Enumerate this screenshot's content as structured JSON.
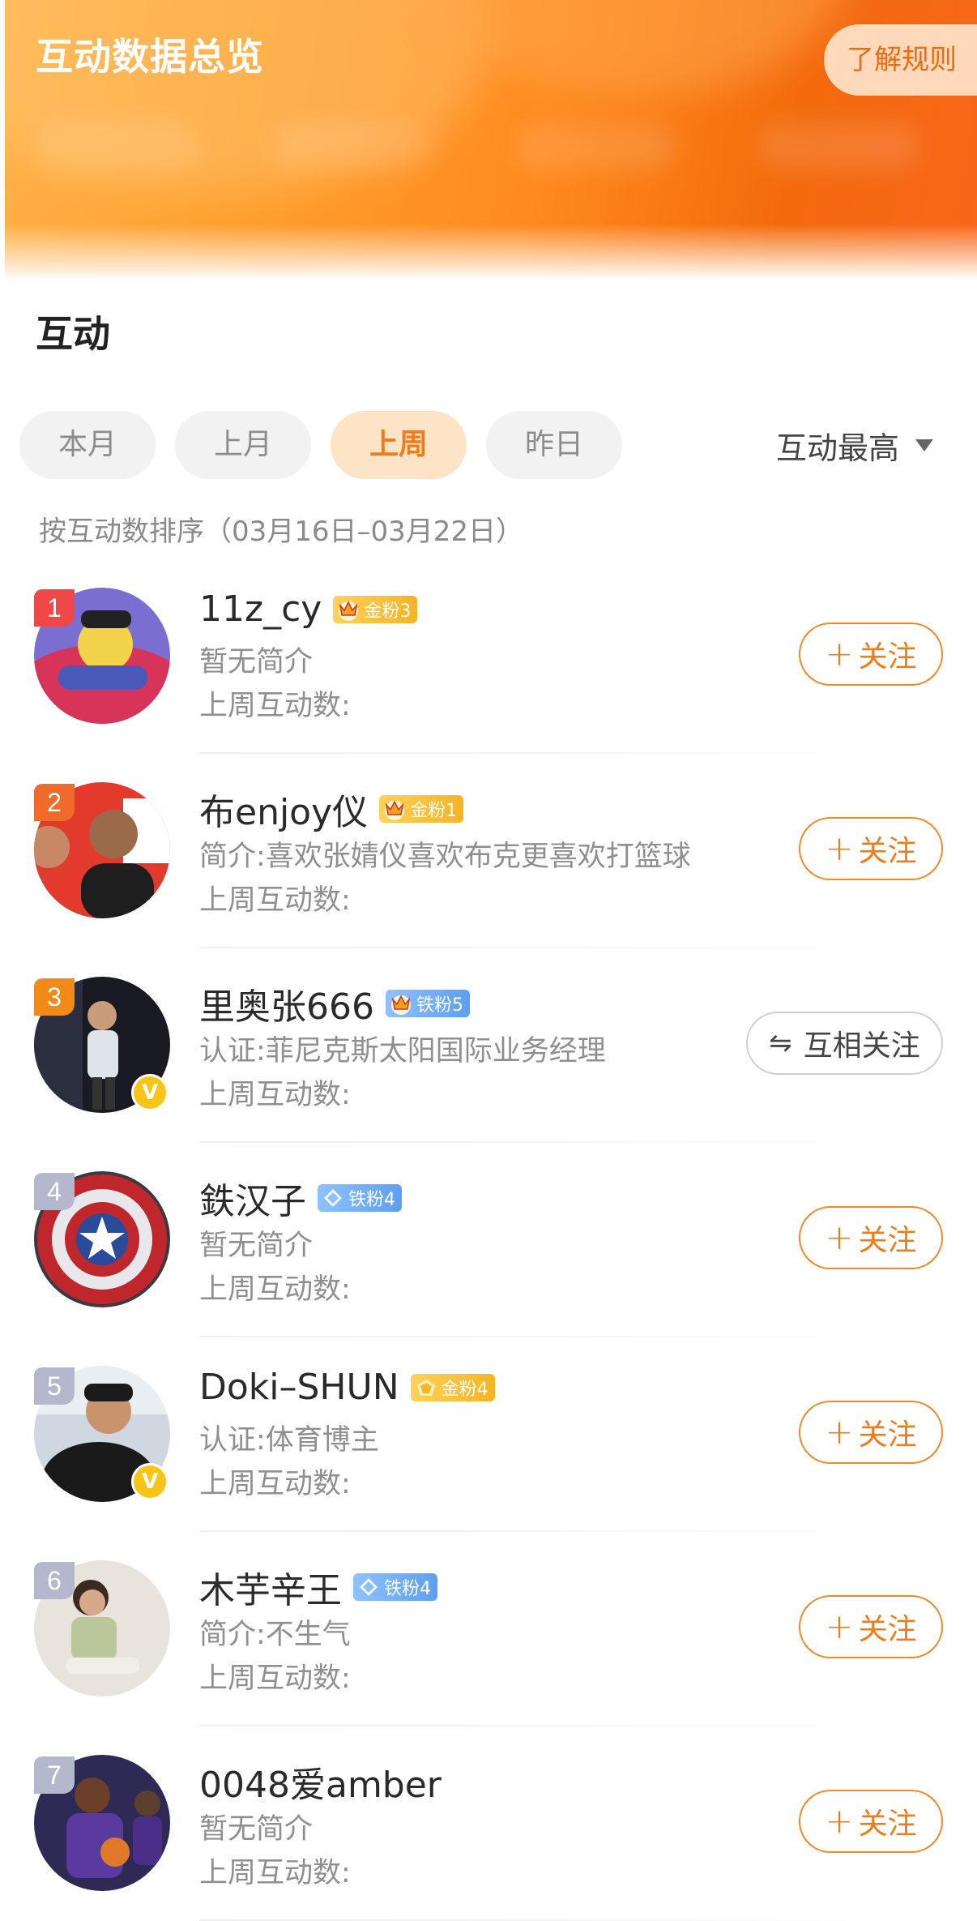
{
  "header": {
    "title": "互动数据总览",
    "rules_label": "了解规则"
  },
  "section": {
    "title": "互动"
  },
  "tabs": [
    {
      "label": "本月",
      "active": false
    },
    {
      "label": "上月",
      "active": false
    },
    {
      "label": "上周",
      "active": true
    },
    {
      "label": "昨日",
      "active": false
    }
  ],
  "sort": {
    "label": "互动最高"
  },
  "range_text": "按互动数排序（03月16日–03月22日）",
  "colors": {
    "accent": "#f07c18",
    "rank_top": [
      "#f04848",
      "#f06a2a",
      "#f08a18"
    ],
    "rank_other": "#b4b8cc",
    "verified": "#f9c416"
  },
  "users": [
    {
      "rank": "1",
      "name": "11z_cy",
      "badge_text": "金粉3",
      "badge_type": "gold",
      "badge_icon": "crown-icon",
      "desc": "暂无简介",
      "count_label": "上周互动数:",
      "button": "关注",
      "button_type": "follow",
      "verified": false,
      "avatar_icon": "cartoon-avatar"
    },
    {
      "rank": "2",
      "name": "布enjoy仪",
      "badge_text": "金粉1",
      "badge_type": "gold",
      "badge_icon": "crown-icon",
      "desc": "简介:喜欢张婧仪喜欢布克更喜欢打篮球",
      "count_label": "上周互动数:",
      "button": "关注",
      "button_type": "follow",
      "verified": false,
      "avatar_icon": "photo-avatar"
    },
    {
      "rank": "3",
      "name": "里奥张666",
      "badge_text": "铁粉5",
      "badge_type": "iron",
      "badge_icon": "crown-icon",
      "desc": "认证:菲尼克斯太阳国际业务经理",
      "count_label": "上周互动数:",
      "button": "互相关注",
      "button_type": "mutual",
      "verified": true,
      "avatar_icon": "photo-avatar"
    },
    {
      "rank": "4",
      "name": "鉄汉子",
      "badge_text": "铁粉4",
      "badge_type": "iron",
      "badge_icon": "diamond-icon",
      "desc": "暂无简介",
      "count_label": "上周互动数:",
      "button": "关注",
      "button_type": "follow",
      "verified": false,
      "avatar_icon": "shield-avatar"
    },
    {
      "rank": "5",
      "name": "Doki–SHUN",
      "badge_text": "金粉4",
      "badge_type": "gold",
      "badge_icon": "pentagon-icon",
      "desc": "认证:体育博主",
      "count_label": "上周互动数:",
      "button": "关注",
      "button_type": "follow",
      "verified": true,
      "avatar_icon": "photo-avatar"
    },
    {
      "rank": "6",
      "name": "木芋辛王",
      "badge_text": "铁粉4",
      "badge_type": "iron",
      "badge_icon": "diamond-icon",
      "desc": "简介:不生气",
      "count_label": "上周互动数:",
      "button": "关注",
      "button_type": "follow",
      "verified": false,
      "avatar_icon": "photo-avatar"
    },
    {
      "rank": "7",
      "name": "0048爱amber",
      "badge_text": "",
      "badge_type": "",
      "badge_icon": "",
      "desc": "暂无简介",
      "count_label": "上周互动数:",
      "button": "关注",
      "button_type": "follow",
      "verified": false,
      "avatar_icon": "photo-avatar"
    }
  ]
}
